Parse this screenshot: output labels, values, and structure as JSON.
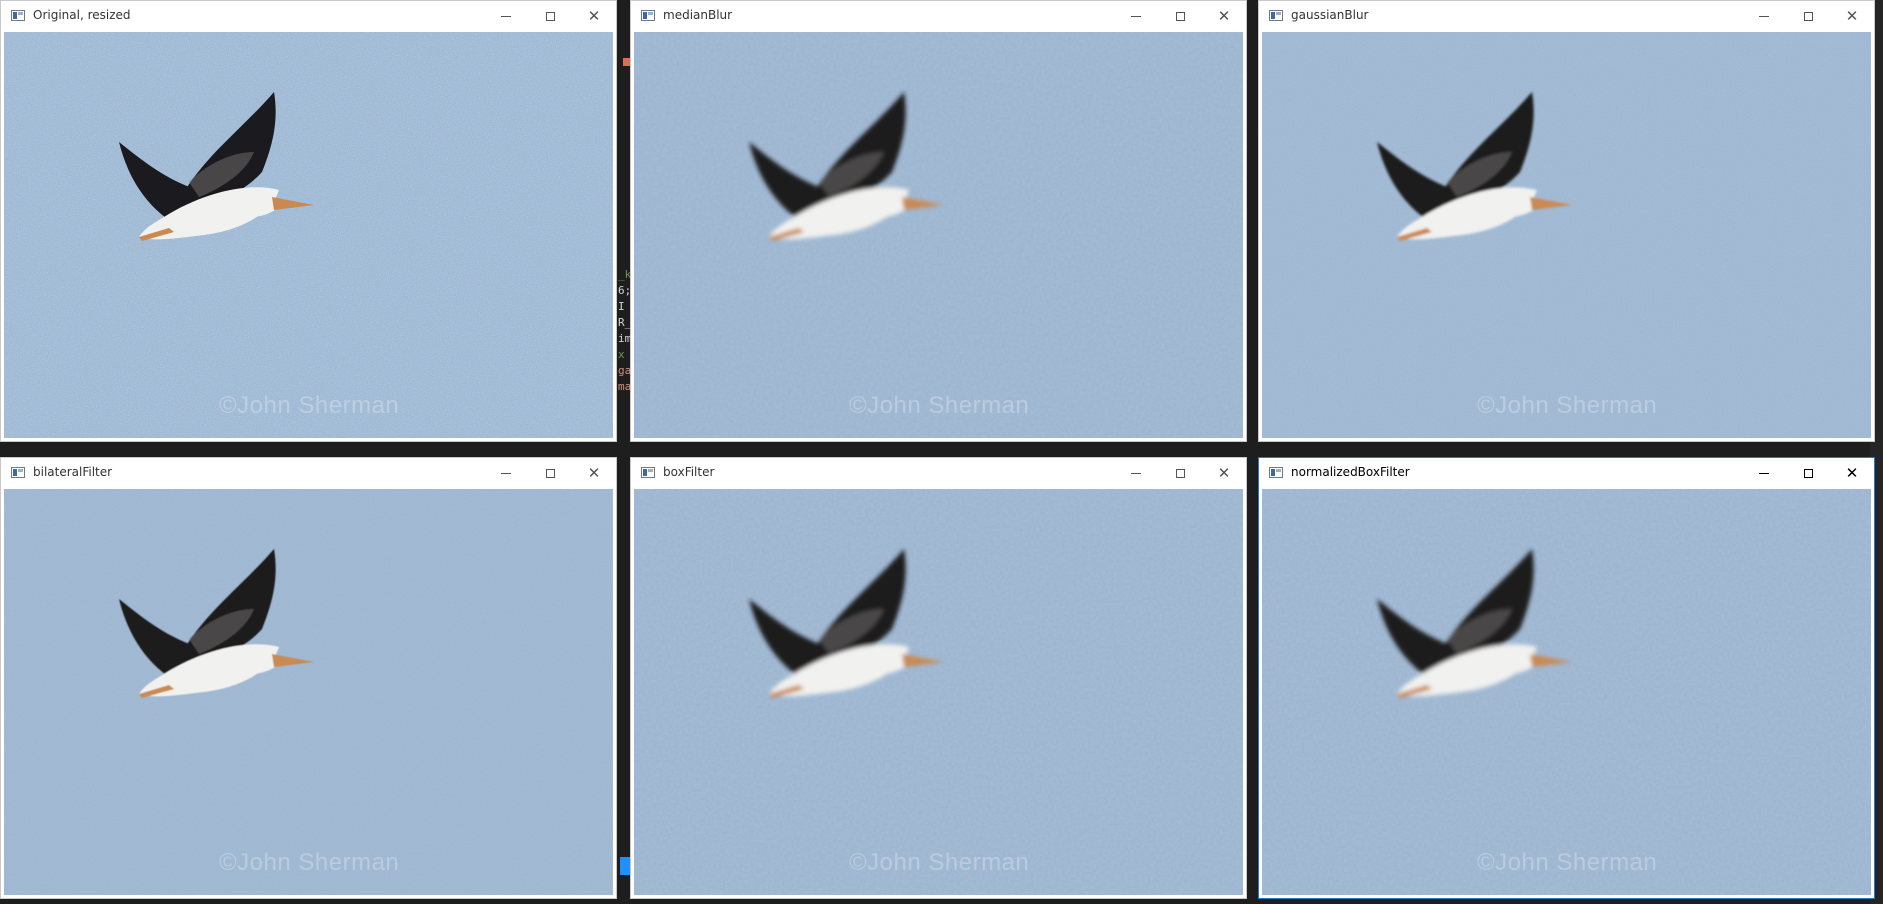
{
  "windows": [
    {
      "id": "original",
      "title": "Original, resized",
      "active": false,
      "noise": "heavy"
    },
    {
      "id": "median",
      "title": "medianBlur",
      "active": false,
      "noise": "blur"
    },
    {
      "id": "gaussian",
      "title": "gaussianBlur",
      "active": false,
      "noise": "medium"
    },
    {
      "id": "bilateral",
      "title": "bilateralFilter",
      "active": false,
      "noise": "light"
    },
    {
      "id": "box",
      "title": "boxFilter",
      "active": false,
      "noise": "blur"
    },
    {
      "id": "normalizedbox",
      "title": "normalizedBoxFilter",
      "active": true,
      "noise": "blur"
    }
  ],
  "controls": {
    "minimize": "minimize-icon",
    "maximize": "maximize-icon",
    "close": "close-icon"
  },
  "watermark": "©John Sherman",
  "background_code": [
    "_k",
    "6;",
    " I",
    "R_",
    "im",
    "x",
    "ga",
    "ma"
  ],
  "colors": {
    "sky": "#9fb6d0",
    "wing_dark": "#1b1a1f",
    "body_white": "#f1f1ef",
    "beak": "#c98a52",
    "active_border": "#1f7ad1"
  }
}
